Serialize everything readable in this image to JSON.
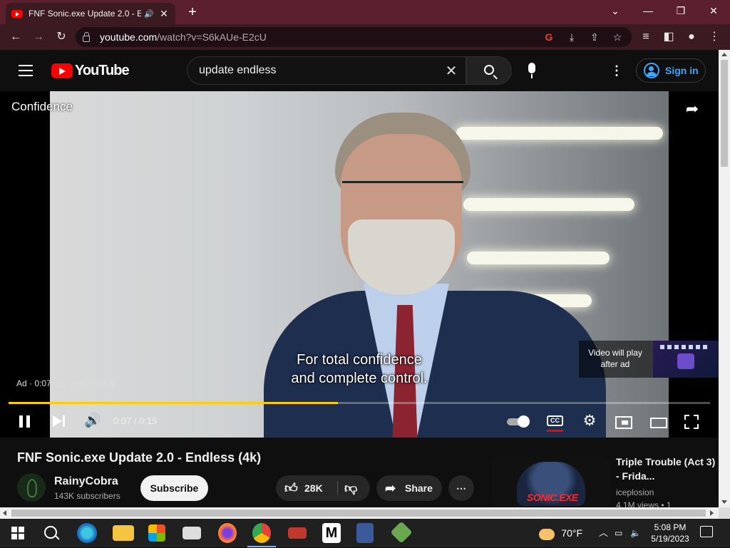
{
  "browser": {
    "tab_title": "FNF Sonic.exe Update 2.0 - E",
    "url_host": "youtube.com",
    "url_path": "/watch?v=S6kAUe-E2cU"
  },
  "youtube": {
    "logo_text": "YouTube",
    "search_query": "update endless",
    "sign_in": "Sign in"
  },
  "player": {
    "ad_title": "Confidence",
    "subtitle_line1": "For total confidence",
    "subtitle_line2": "and complete control.",
    "ad_label": "Ad · 0:07",
    "ad_domain": "usps.com",
    "next_label": "Video will play after ad",
    "time": "0:07 / 0:15",
    "progress_fraction": 0.47
  },
  "video": {
    "title": "FNF Sonic.exe Update 2.0 - Endless (4k)",
    "channel": "RainyCobra",
    "subscribers": "143K subscribers",
    "subscribe_label": "Subscribe",
    "likes": "28K",
    "share_label": "Share"
  },
  "recommendation": {
    "title": "Triple Trouble (Act 3) - Frida...",
    "channel": "iceplosion",
    "meta": "4.1M views • 1",
    "thumb_text": "SONIC.EXE"
  },
  "taskbar": {
    "weather": "70°F",
    "time": "5:08 PM",
    "date": "5/19/2023"
  },
  "colors": {
    "accent_red": "#ff0000",
    "progress_yellow": "#ffcc00",
    "link_blue": "#3ea6ff"
  }
}
